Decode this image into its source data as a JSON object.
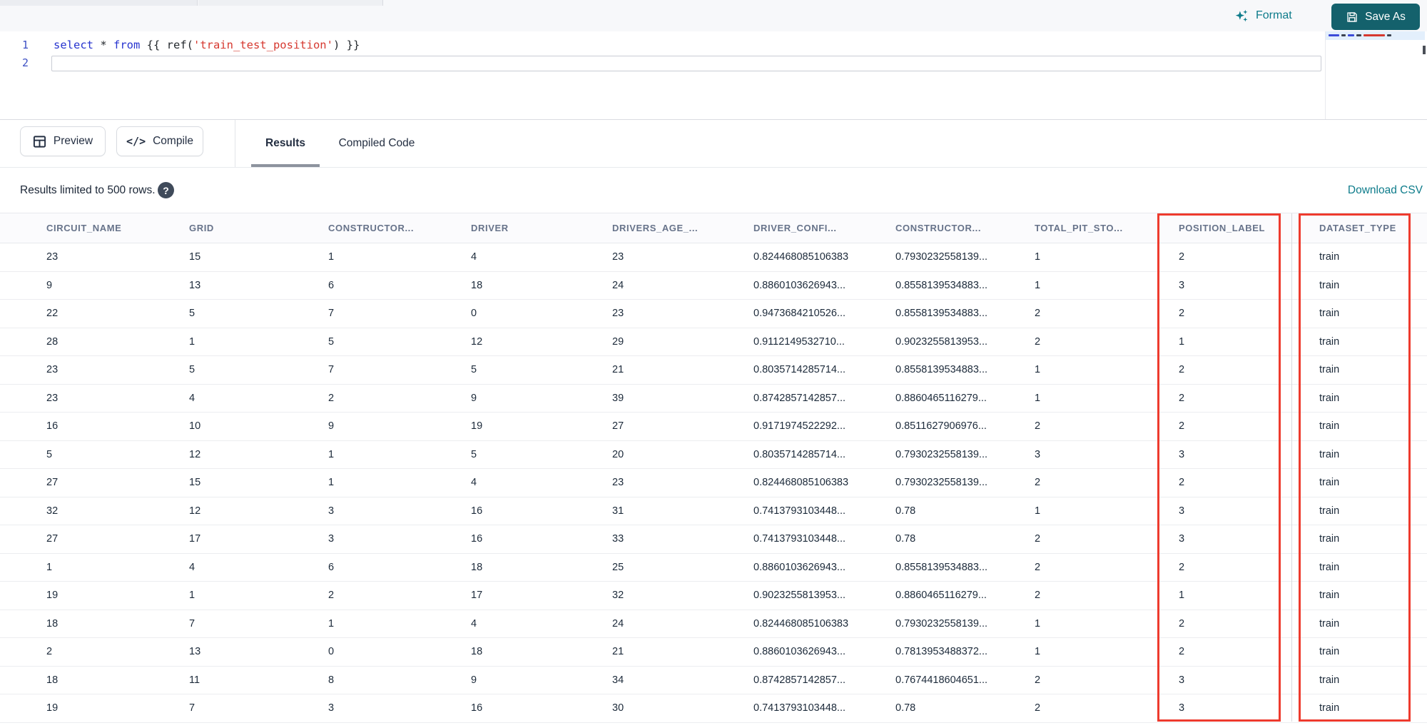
{
  "top_bar": {
    "format_label": "Format",
    "save_as_label": "Save As"
  },
  "editor": {
    "line_numbers": [
      "1",
      "2"
    ],
    "code_tokens": {
      "select": "select",
      "star_sp": " * ",
      "from": "from",
      "jinja_open": " {{ ",
      "ref_open": "ref(",
      "string": "'train_test_position'",
      "ref_close": ") ",
      "jinja_close": "}}"
    }
  },
  "toolbar": {
    "preview_label": "Preview",
    "compile_label": "Compile",
    "compile_glyph": "</>",
    "tabs": [
      {
        "label": "Results",
        "active": true
      },
      {
        "label": "Compiled Code",
        "active": false
      }
    ]
  },
  "results_bar": {
    "limit_text": "Results limited to 500 rows.",
    "help_glyph": "?",
    "download_label": "Download CSV"
  },
  "table": {
    "columns": [
      "CIRCUIT_NAME",
      "GRID",
      "CONSTRUCTOR...",
      "DRIVER",
      "DRIVERS_AGE_...",
      "DRIVER_CONFI...",
      "CONSTRUCTOR...",
      "TOTAL_PIT_STO...",
      "POSITION_LABEL",
      "DATASET_TYPE"
    ],
    "rows": [
      [
        "23",
        "15",
        "1",
        "4",
        "23",
        "0.824468085106383",
        "0.7930232558139...",
        "1",
        "2",
        "train"
      ],
      [
        "9",
        "13",
        "6",
        "18",
        "24",
        "0.8860103626943...",
        "0.8558139534883...",
        "1",
        "3",
        "train"
      ],
      [
        "22",
        "5",
        "7",
        "0",
        "23",
        "0.9473684210526...",
        "0.8558139534883...",
        "2",
        "2",
        "train"
      ],
      [
        "28",
        "1",
        "5",
        "12",
        "29",
        "0.9112149532710...",
        "0.9023255813953...",
        "2",
        "1",
        "train"
      ],
      [
        "23",
        "5",
        "7",
        "5",
        "21",
        "0.8035714285714...",
        "0.8558139534883...",
        "1",
        "2",
        "train"
      ],
      [
        "23",
        "4",
        "2",
        "9",
        "39",
        "0.8742857142857...",
        "0.8860465116279...",
        "1",
        "2",
        "train"
      ],
      [
        "16",
        "10",
        "9",
        "19",
        "27",
        "0.9171974522292...",
        "0.8511627906976...",
        "2",
        "2",
        "train"
      ],
      [
        "5",
        "12",
        "1",
        "5",
        "20",
        "0.8035714285714...",
        "0.7930232558139...",
        "3",
        "3",
        "train"
      ],
      [
        "27",
        "15",
        "1",
        "4",
        "23",
        "0.824468085106383",
        "0.7930232558139...",
        "2",
        "2",
        "train"
      ],
      [
        "32",
        "12",
        "3",
        "16",
        "31",
        "0.7413793103448...",
        "0.78",
        "1",
        "3",
        "train"
      ],
      [
        "27",
        "17",
        "3",
        "16",
        "33",
        "0.7413793103448...",
        "0.78",
        "2",
        "3",
        "train"
      ],
      [
        "1",
        "4",
        "6",
        "18",
        "25",
        "0.8860103626943...",
        "0.8558139534883...",
        "2",
        "2",
        "train"
      ],
      [
        "19",
        "1",
        "2",
        "17",
        "32",
        "0.9023255813953...",
        "0.8860465116279...",
        "2",
        "1",
        "train"
      ],
      [
        "18",
        "7",
        "1",
        "4",
        "24",
        "0.824468085106383",
        "0.7930232558139...",
        "1",
        "2",
        "train"
      ],
      [
        "2",
        "13",
        "0",
        "18",
        "21",
        "0.8860103626943...",
        "0.7813953488372...",
        "1",
        "2",
        "train"
      ],
      [
        "18",
        "11",
        "8",
        "9",
        "34",
        "0.8742857142857...",
        "0.7674418604651...",
        "2",
        "3",
        "train"
      ],
      [
        "19",
        "7",
        "3",
        "16",
        "30",
        "0.7413793103448...",
        "0.78",
        "2",
        "3",
        "train"
      ]
    ],
    "highlighted_columns": [
      "POSITION_LABEL",
      "DATASET_TYPE"
    ],
    "highlight_color": "#ee3b2e"
  },
  "colors": {
    "accent_teal": "#0e7c8b",
    "save_button_bg": "#14616c",
    "highlight_red": "#ee3b2e"
  }
}
